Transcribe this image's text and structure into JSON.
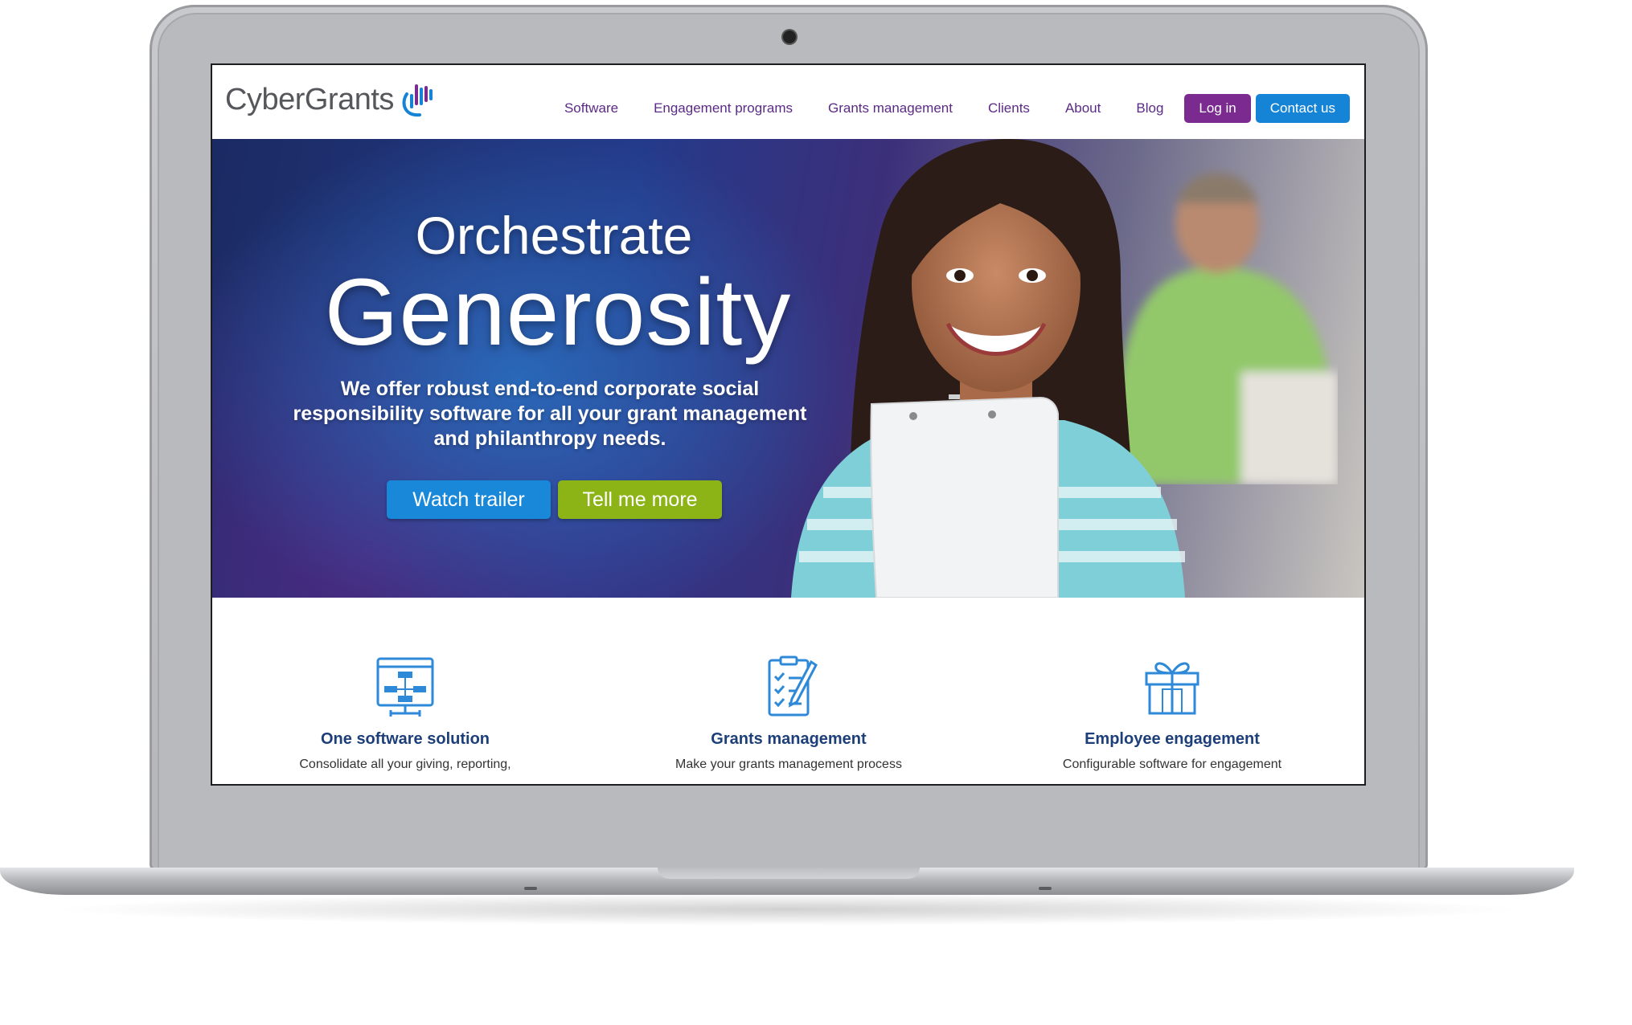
{
  "site": {
    "logo_text": "CyberGrants",
    "nav": [
      {
        "label": "Software"
      },
      {
        "label": "Engagement programs"
      },
      {
        "label": "Grants management"
      },
      {
        "label": "Clients"
      },
      {
        "label": "About"
      },
      {
        "label": "Blog"
      }
    ],
    "login_label": "Log in",
    "contact_label": "Contact us"
  },
  "hero": {
    "title_line1": "Orchestrate",
    "title_line2": "Generosity",
    "subtitle": "We offer robust end-to-end corporate social responsibility software for all your grant management and philanthropy needs.",
    "watch_label": "Watch trailer",
    "more_label": "Tell me more"
  },
  "features": [
    {
      "icon": "org-chart-icon",
      "title": "One software solution",
      "desc": "Consolidate all your giving, reporting,"
    },
    {
      "icon": "checklist-icon",
      "title": "Grants management",
      "desc": "Make your grants management process"
    },
    {
      "icon": "gift-icon",
      "title": "Employee engagement",
      "desc": "Configurable software for engagement"
    }
  ],
  "colors": {
    "nav_text": "#5b2a86",
    "login_button": "#7b2a90",
    "contact_button": "#1583d6",
    "watch_button": "#1a88d9",
    "more_button": "#8db416",
    "feature_title": "#1d3f79",
    "icon_blue": "#2e8ad8"
  }
}
